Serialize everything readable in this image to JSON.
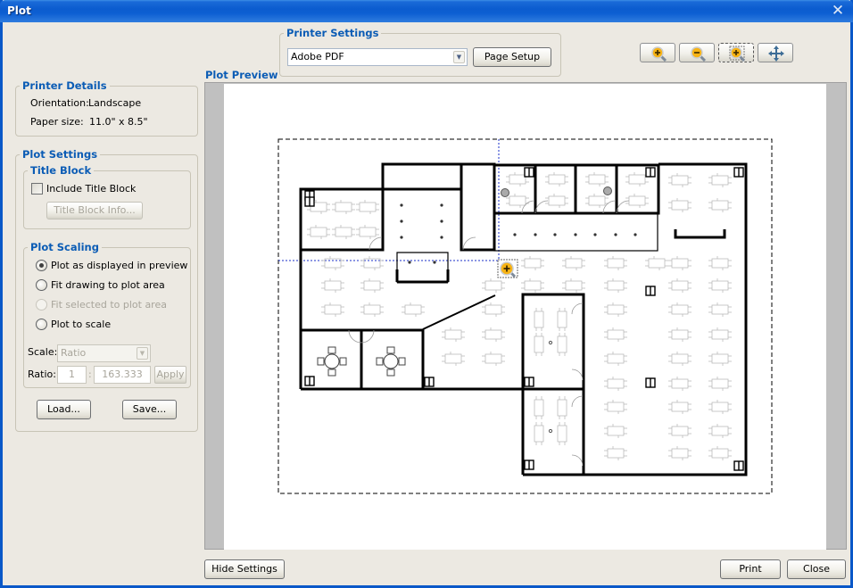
{
  "window": {
    "title": "Plot",
    "close_icon": "close-icon"
  },
  "printer_settings": {
    "legend": "Printer Settings",
    "printer_selected": "Adobe PDF",
    "page_setup_label": "Page Setup"
  },
  "toolbar": {
    "buttons": [
      {
        "name": "zoom-in",
        "icon": "zoom-in-icon"
      },
      {
        "name": "zoom-out",
        "icon": "zoom-out-icon"
      },
      {
        "name": "zoom-window",
        "icon": "zoom-window-icon",
        "active": true
      },
      {
        "name": "pan",
        "icon": "pan-icon"
      }
    ]
  },
  "printer_details": {
    "legend": "Printer Details",
    "orientation_label": "Orientation:",
    "orientation_value": "Landscape",
    "paper_size_label": "Paper size:",
    "paper_size_value": "11.0\" x 8.5\""
  },
  "plot_settings": {
    "legend": "Plot Settings",
    "title_block": {
      "legend": "Title Block",
      "include_label": "Include Title Block",
      "include_checked": false,
      "info_button": "Title Block Info..."
    },
    "plot_scaling": {
      "legend": "Plot Scaling",
      "options": [
        {
          "label": "Plot as displayed in preview",
          "checked": true,
          "enabled": true
        },
        {
          "label": "Fit drawing to plot area",
          "checked": false,
          "enabled": true
        },
        {
          "label": "Fit selected to plot area",
          "checked": false,
          "enabled": false
        },
        {
          "label": "Plot to scale",
          "checked": false,
          "enabled": true
        }
      ],
      "scale_label": "Scale:",
      "scale_value": "Ratio",
      "ratio_label": "Ratio:",
      "ratio_left": "1",
      "ratio_separator": ":",
      "ratio_right": "163.333",
      "apply_label": "Apply"
    },
    "load_label": "Load...",
    "save_label": "Save..."
  },
  "preview": {
    "label": "Plot Preview"
  },
  "footer": {
    "hide_settings_label": "Hide Settings",
    "print_label": "Print",
    "close_label": "Close"
  }
}
